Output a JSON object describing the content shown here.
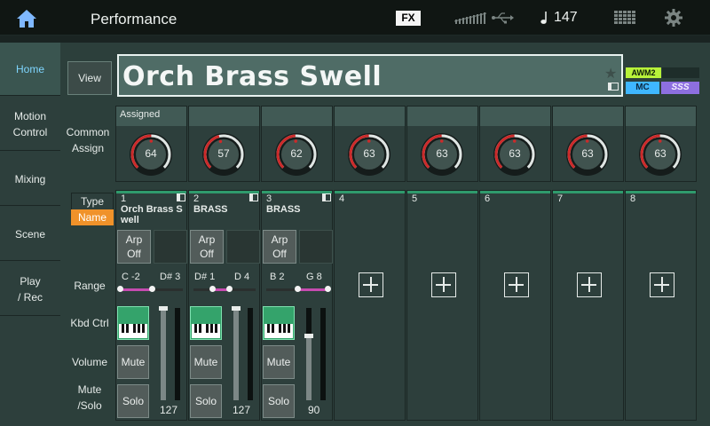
{
  "topbar": {
    "title": "Performance",
    "fx_label": "FX",
    "tempo": "147"
  },
  "sidebar": {
    "items": [
      {
        "label": "Home"
      },
      {
        "label": "Motion\nControl"
      },
      {
        "label": "Mixing"
      },
      {
        "label": "Scene"
      },
      {
        "label": "Play\n/ Rec"
      }
    ]
  },
  "header": {
    "view_label": "View",
    "performance_name": "Orch Brass Swell",
    "awm2_label": "AWM2",
    "mc_label": "MC",
    "sss_label": "SSS"
  },
  "common_assign": {
    "row_label": "Common\nAssign",
    "assigned_label": "Assigned",
    "knobs": [
      64,
      57,
      62,
      63,
      63,
      63,
      63,
      63
    ]
  },
  "labels": {
    "type": "Type",
    "name": "Name",
    "range": "Range",
    "kbd_ctrl": "Kbd Ctrl",
    "volume": "Volume",
    "mute_solo": "Mute\n/Solo"
  },
  "parts": [
    {
      "num": "1",
      "name": "Orch Brass S well",
      "arp": "Arp\nOff",
      "range_low": "C -2",
      "range_high": "D# 3",
      "mute": "Mute",
      "solo": "Solo",
      "volume": "127"
    },
    {
      "num": "2",
      "name": "BRASS",
      "arp": "Arp\nOff",
      "range_low": "D# 1",
      "range_high": "D 4",
      "mute": "Mute",
      "solo": "Solo",
      "volume": "127"
    },
    {
      "num": "3",
      "name": "BRASS",
      "arp": "Arp\nOff",
      "range_low": "B 2",
      "range_high": "G 8",
      "mute": "Mute",
      "solo": "Solo",
      "volume": "90"
    },
    {
      "num": "4"
    },
    {
      "num": "5"
    },
    {
      "num": "6"
    },
    {
      "num": "7"
    },
    {
      "num": "8"
    }
  ],
  "colors": {
    "accent_name_tab": "#f0922a",
    "kbd_ctrl_on": "#34a36b",
    "range_fill": "#c64bb0",
    "knob_ring": "#cc2a2a"
  }
}
